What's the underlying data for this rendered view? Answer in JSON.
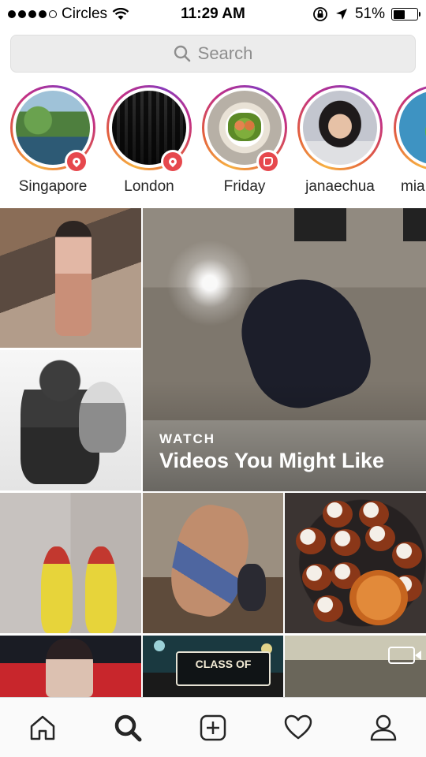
{
  "status_bar": {
    "carrier": "Circles",
    "time": "11:29 AM",
    "battery_percent": "51%",
    "battery_level": 0.51,
    "signal_bars_filled": 4,
    "signal_bars_total": 5
  },
  "search": {
    "placeholder": "Search"
  },
  "stories": [
    {
      "label": "Singapore",
      "badge": "location-pin-icon"
    },
    {
      "label": "London",
      "badge": "location-pin-icon"
    },
    {
      "label": "Friday",
      "badge": "story-sticker-icon"
    },
    {
      "label": "janaechua",
      "badge": null
    },
    {
      "label": "mia",
      "badge": null
    }
  ],
  "explore": {
    "watch_label": "WATCH",
    "watch_title": "Videos You Might Like",
    "graduation_board_text": "CLASS OF"
  },
  "tab_bar": {
    "items": [
      "home-icon",
      "search-icon",
      "new-post-icon",
      "activity-heart-icon",
      "profile-icon"
    ],
    "active": "search-icon"
  },
  "colors": {
    "badge_red": "#e6484d",
    "story_ring_start": "#f7b041",
    "story_ring_end": "#8a3ab9",
    "search_bg": "#ececec"
  }
}
